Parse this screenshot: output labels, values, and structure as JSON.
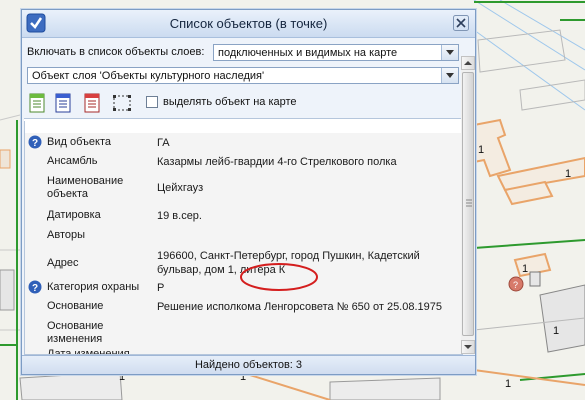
{
  "window": {
    "title": "Список объектов (в точке)"
  },
  "layers_filter": {
    "label": "Включать в список объекты слоев:",
    "value": "подключенных и видимых на карте"
  },
  "object_select": {
    "value": "Объект слоя 'Объекты культурного наследия'"
  },
  "toolbar": {
    "checkbox_label": "выделять объект на карте",
    "checkbox_checked": false
  },
  "properties": [
    {
      "key": "Вид объекта",
      "value": "ГА",
      "info": true
    },
    {
      "key": "Ансамбль",
      "value": "Казармы лейб-гвардии 4-го Стрелкового полка",
      "info": false
    },
    {
      "key": "Наименование объекта",
      "value": "Цейхгауз",
      "info": false
    },
    {
      "key": "Датировка",
      "value": "19 в.сер.",
      "info": false
    },
    {
      "key": "Авторы",
      "value": "",
      "info": false
    },
    {
      "key": "Адрес",
      "value": "196600, Санкт-Петербург, город Пушкин, Кадетский бульвар, дом 1, литера К",
      "info": false
    },
    {
      "key": "Категория охраны",
      "value": "Р",
      "info": true
    },
    {
      "key": "Основание",
      "value": "Решение исполкома Ленгорсовета № 650 от 25.08.1975",
      "info": false
    },
    {
      "key": "Основание изменения",
      "value": "",
      "info": false
    },
    {
      "key": "Дата изменения",
      "value": "",
      "info": false
    }
  ],
  "status": {
    "text": "Найдено объектов: 3"
  },
  "map": {
    "labels": [
      "1",
      "1",
      "1",
      "1",
      "1",
      "1",
      "1"
    ]
  },
  "colors": {
    "building_outline": "#e9a469",
    "green_line": "#2e9a2e",
    "info_blue": "#2f5fb8"
  }
}
